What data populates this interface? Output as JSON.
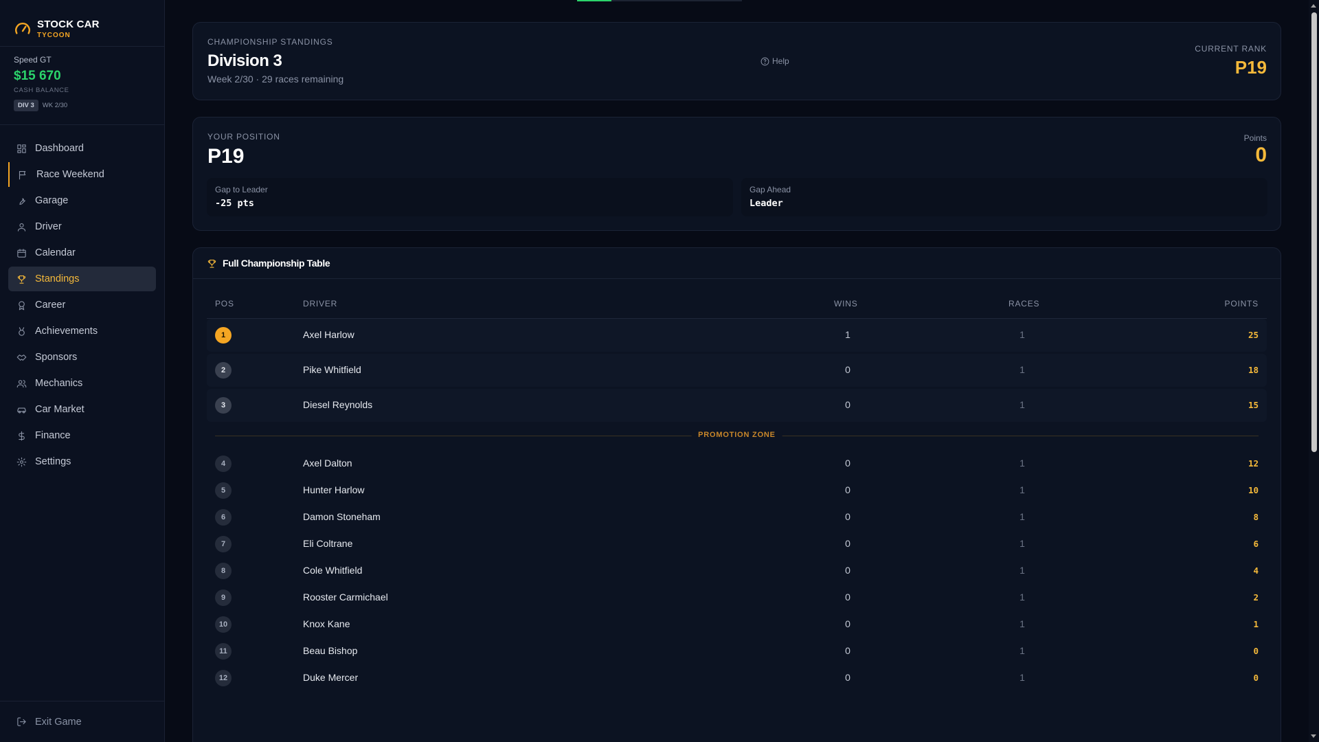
{
  "brand": {
    "name": "STOCK CAR",
    "sub": "TYCOON"
  },
  "account": {
    "team": "Speed GT",
    "cash": "$15 670",
    "cash_caption": "CASH BALANCE",
    "division_badge": "DIV 3",
    "week_badge": "WK 2/30"
  },
  "nav": [
    {
      "label": "Dashboard",
      "icon": "grid-icon"
    },
    {
      "label": "Race Weekend",
      "icon": "flag-icon"
    },
    {
      "label": "Garage",
      "icon": "wrench-icon"
    },
    {
      "label": "Driver",
      "icon": "user-icon"
    },
    {
      "label": "Calendar",
      "icon": "calendar-icon"
    },
    {
      "label": "Standings",
      "icon": "trophy-icon"
    },
    {
      "label": "Career",
      "icon": "award-icon"
    },
    {
      "label": "Achievements",
      "icon": "medal-icon"
    },
    {
      "label": "Sponsors",
      "icon": "handshake-icon"
    },
    {
      "label": "Mechanics",
      "icon": "users-icon"
    },
    {
      "label": "Car Market",
      "icon": "car-icon"
    },
    {
      "label": "Finance",
      "icon": "dollar-icon"
    },
    {
      "label": "Settings",
      "icon": "gear-icon"
    }
  ],
  "active_nav": "Standings",
  "exit_label": "Exit Game",
  "header": {
    "eyebrow": "CHAMPIONSHIP STANDINGS",
    "title": "Division 3",
    "subtitle": "Week 2/30 · 29 races remaining",
    "help_label": "Help",
    "rank_label": "CURRENT RANK",
    "rank_value": "P19"
  },
  "position": {
    "eyebrow": "YOUR POSITION",
    "value": "P19",
    "points_label": "Points",
    "points_value": "0",
    "gap_leader_label": "Gap to Leader",
    "gap_leader_value": "-25 pts",
    "gap_ahead_label": "Gap Ahead",
    "gap_ahead_value": "Leader"
  },
  "table": {
    "title": "Full Championship Table",
    "columns": {
      "pos": "POS",
      "driver": "DRIVER",
      "wins": "WINS",
      "races": "RACES",
      "points": "POINTS"
    },
    "promotion_label": "PROMOTION ZONE",
    "rows": [
      {
        "pos": "1",
        "driver": "Axel Harlow",
        "wins": "1",
        "races": "1",
        "points": "25"
      },
      {
        "pos": "2",
        "driver": "Pike Whitfield",
        "wins": "0",
        "races": "1",
        "points": "18"
      },
      {
        "pos": "3",
        "driver": "Diesel Reynolds",
        "wins": "0",
        "races": "1",
        "points": "15"
      },
      {
        "pos": "4",
        "driver": "Axel Dalton",
        "wins": "0",
        "races": "1",
        "points": "12"
      },
      {
        "pos": "5",
        "driver": "Hunter Harlow",
        "wins": "0",
        "races": "1",
        "points": "10"
      },
      {
        "pos": "6",
        "driver": "Damon Stoneham",
        "wins": "0",
        "races": "1",
        "points": "8"
      },
      {
        "pos": "7",
        "driver": "Eli Coltrane",
        "wins": "0",
        "races": "1",
        "points": "6"
      },
      {
        "pos": "8",
        "driver": "Cole Whitfield",
        "wins": "0",
        "races": "1",
        "points": "4"
      },
      {
        "pos": "9",
        "driver": "Rooster Carmichael",
        "wins": "0",
        "races": "1",
        "points": "2"
      },
      {
        "pos": "10",
        "driver": "Knox Kane",
        "wins": "0",
        "races": "1",
        "points": "1"
      },
      {
        "pos": "11",
        "driver": "Beau Bishop",
        "wins": "0",
        "races": "1",
        "points": "0"
      },
      {
        "pos": "12",
        "driver": "Duke Mercer",
        "wins": "0",
        "races": "1",
        "points": "0"
      }
    ]
  },
  "colors": {
    "accent": "#f5a623",
    "cash": "#2bd46b",
    "bg": "#070b16"
  }
}
